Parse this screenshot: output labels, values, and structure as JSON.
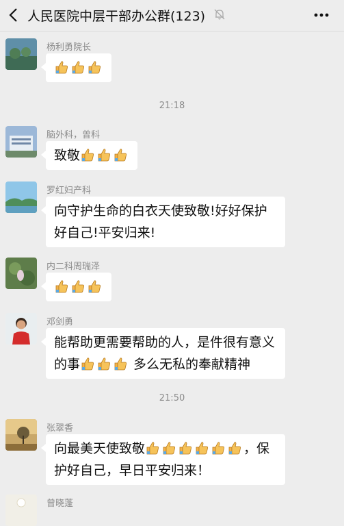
{
  "header": {
    "title": "人民医院中层干部办公群(123)",
    "back_icon": "chevron-left-icon",
    "mute_icon": "bell-off-icon",
    "more_icon": "more-horizontal-icon"
  },
  "colors": {
    "background": "#ededed",
    "bubble": "#ffffff",
    "meta_text": "#8a8a8a"
  },
  "timestamps": [
    "21:18",
    "21:50"
  ],
  "messages": [
    {
      "sender": "杨利勇院长",
      "text_before": "",
      "thumbs": 3,
      "text_after": ""
    },
    {
      "sender": "脑外科，曾科",
      "text_before": "致敬",
      "thumbs": 3,
      "text_after": ""
    },
    {
      "sender": "罗红妇产科",
      "text_before": "向守护生命的白衣天使致敬!好好保护好自己!平安归来!",
      "thumbs": 0,
      "text_after": ""
    },
    {
      "sender": "内二科周瑞泽",
      "text_before": "",
      "thumbs": 3,
      "text_after": ""
    },
    {
      "sender": "邓剑勇",
      "text_before": "能帮助更需要帮助的人，是件很有意义的事",
      "thumbs": 3,
      "text_after": " 多么无私的奉献精神"
    },
    {
      "sender": "张翠香",
      "text_before": "向最美天使致敬",
      "thumbs": 6,
      "text_after": "，保护好自己，早日平安归来！"
    },
    {
      "sender": "曾晓蓬",
      "text_before": "",
      "thumbs": 0,
      "text_after": ""
    }
  ]
}
